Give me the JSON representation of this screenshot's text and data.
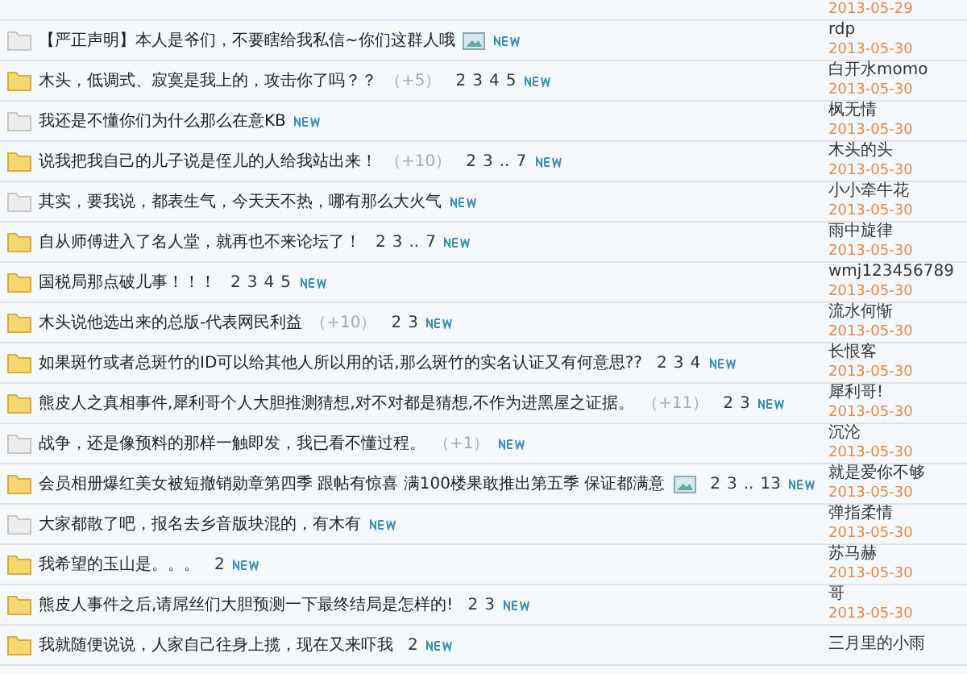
{
  "top_row": {
    "date": "2013-05-29"
  },
  "threads": [
    {
      "title": "【严正声明】本人是爷们，不要瞎给我私信~你们这群人哦",
      "hot": false,
      "image": true,
      "new": true,
      "author": "rdp",
      "date": "2013-05-30"
    },
    {
      "title": "木头，低调式、寂寞是我上的，攻击你了吗？？",
      "hot": true,
      "image": false,
      "bonus": "（+5）",
      "pages": [
        "2",
        "3",
        "4",
        "5"
      ],
      "new": true,
      "author": "白开水momo",
      "date": "2013-05-30"
    },
    {
      "title": "我还是不懂你们为什么那么在意KB",
      "hot": false,
      "image": false,
      "new": true,
      "author": "枫无情",
      "date": "2013-05-30"
    },
    {
      "title": "说我把我自己的儿子说是侄儿的人给我站出来！",
      "hot": true,
      "image": false,
      "bonus": "（+10）",
      "pages": [
        "2",
        "3",
        "..",
        "7"
      ],
      "new": true,
      "author": "木头的头",
      "date": "2013-05-30"
    },
    {
      "title": "其实，要我说，都表生气，今天天不热，哪有那么大火气",
      "hot": false,
      "image": false,
      "new": true,
      "author": "小小牵牛花",
      "date": "2013-05-30"
    },
    {
      "title": "自从师傅进入了名人堂，就再也不来论坛了！",
      "hot": true,
      "image": false,
      "pages": [
        "2",
        "3",
        "..",
        "7"
      ],
      "new": true,
      "author": "雨中旋律",
      "date": "2013-05-30"
    },
    {
      "title": "国税局那点破儿事！！！",
      "hot": true,
      "image": false,
      "pages": [
        "2",
        "3",
        "4",
        "5"
      ],
      "new": true,
      "author": "wmj123456789",
      "date": "2013-05-30"
    },
    {
      "title": "木头说他选出来的总版-代表网民利益",
      "hot": true,
      "image": false,
      "bonus": "（+10）",
      "pages": [
        "2",
        "3"
      ],
      "new": true,
      "author": "流水何惭",
      "date": "2013-05-30"
    },
    {
      "title": "如果斑竹或者总斑竹的ID可以给其他人所以用的话,那么斑竹的实名认证又有何意思??",
      "hot": true,
      "image": false,
      "pages": [
        "2",
        "3",
        "4"
      ],
      "new": true,
      "author": "长恨客",
      "date": "2013-05-30"
    },
    {
      "title": "熊皮人之真相事件,犀利哥个人大胆推测猜想,对不对都是猜想,不作为进黑屋之证据。",
      "hot": true,
      "image": false,
      "bonus": "（+11）",
      "pages": [
        "2",
        "3"
      ],
      "new": true,
      "author": "犀利哥!",
      "date": "2013-05-30"
    },
    {
      "title": "战争，还是像预料的那样一触即发，我已看不懂过程。",
      "hot": false,
      "image": false,
      "bonus": "（+1）",
      "new": true,
      "author": "沉沦",
      "date": "2013-05-30"
    },
    {
      "title": "会员相册爆红美女被短撤销勋章第四季 跟帖有惊喜 满100楼果敢推出第五季 保证都满意",
      "hot": true,
      "image": true,
      "pages": [
        "2",
        "3",
        "..",
        "13"
      ],
      "new": true,
      "author": "就是爱你不够",
      "date": "2013-05-30"
    },
    {
      "title": "大家都散了吧，报名去乡音版块混的，有木有",
      "hot": false,
      "image": false,
      "new": true,
      "author": "弹指柔情",
      "date": "2013-05-30"
    },
    {
      "title": "我希望的玉山是。。。",
      "hot": true,
      "image": false,
      "pages": [
        "2"
      ],
      "new": true,
      "author": "苏马赫",
      "date": "2013-05-30"
    },
    {
      "title": "熊皮人事件之后,请屌丝们大胆预测一下最终结局是怎样的!",
      "hot": true,
      "image": false,
      "pages": [
        "2",
        "3"
      ],
      "new": true,
      "author": "哥",
      "date": "2013-05-30"
    },
    {
      "title": "我就随便说说，人家自己往身上揽，现在又来吓我",
      "hot": true,
      "image": false,
      "pages": [
        "2"
      ],
      "new": true,
      "author": "三月里的小雨"
    }
  ]
}
